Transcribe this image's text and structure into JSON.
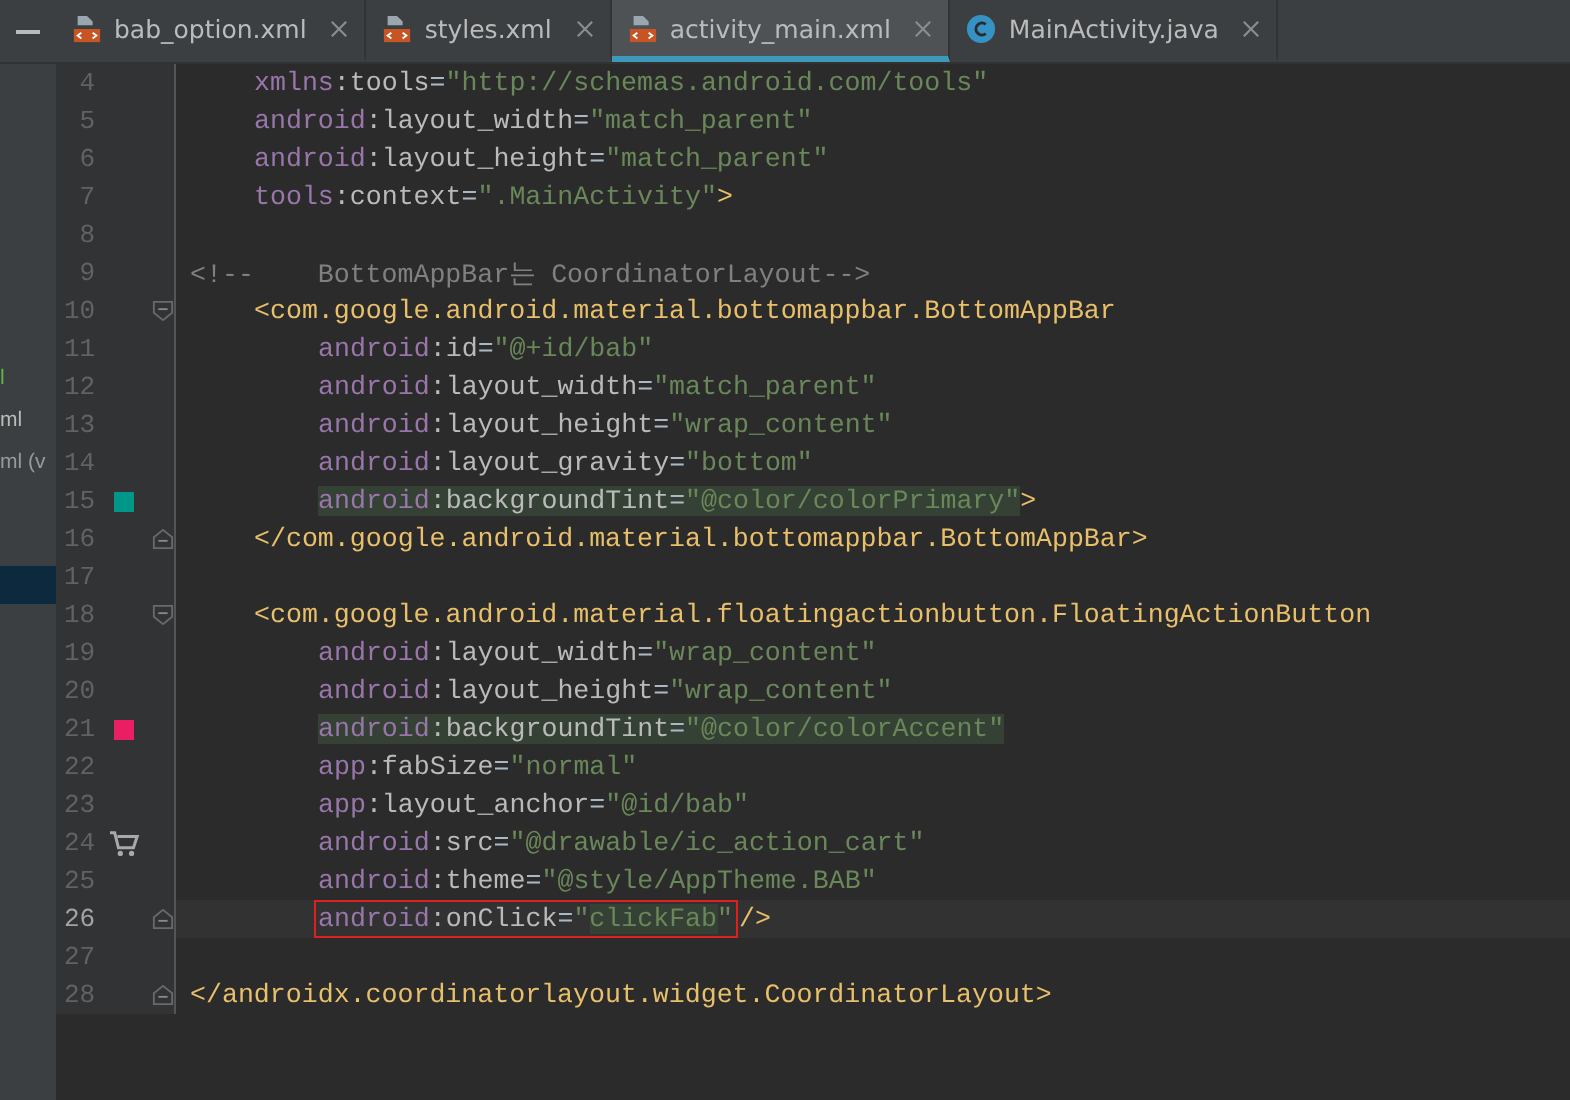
{
  "tabs": [
    {
      "label": "bab_option.xml",
      "kind": "xml",
      "selected": false
    },
    {
      "label": "styles.xml",
      "kind": "xml",
      "selected": false
    },
    {
      "label": "activity_main.xml",
      "kind": "xml",
      "selected": true
    },
    {
      "label": "MainActivity.java",
      "kind": "class",
      "selected": false
    }
  ],
  "sidebar": {
    "items": [
      {
        "text": "l",
        "color": "#62b543",
        "selected": false
      },
      {
        "text": "ml",
        "color": "#bbbbbb",
        "selected": false
      },
      {
        "text": "ml (v",
        "color": "#999999",
        "selected": false
      },
      {
        "selected": true
      }
    ]
  },
  "editor": {
    "lines": [
      {
        "number": "4",
        "kind": "attr",
        "segments": [
          {
            "kind": "text",
            "tokens": [
              {
                "t": "xmlns",
                "kind": "ns"
              },
              {
                "t": ":tools",
                "kind": "attr"
              },
              {
                "t": "=",
                "kind": "punct"
              },
              {
                "t": "\"http://schemas.android.com/tools\"",
                "kind": "value"
              }
            ]
          }
        ]
      },
      {
        "number": "5",
        "kind": "attr",
        "segments": [
          {
            "kind": "text",
            "tokens": [
              {
                "t": "android",
                "kind": "ns"
              },
              {
                "t": ":layout_width",
                "kind": "attr"
              },
              {
                "t": "=",
                "kind": "punct"
              },
              {
                "t": "\"match_parent\"",
                "kind": "value"
              }
            ]
          }
        ]
      },
      {
        "number": "6",
        "kind": "attr",
        "segments": [
          {
            "kind": "text",
            "tokens": [
              {
                "t": "android",
                "kind": "ns"
              },
              {
                "t": ":layout_height",
                "kind": "attr"
              },
              {
                "t": "=",
                "kind": "punct"
              },
              {
                "t": "\"match_parent\"",
                "kind": "value"
              }
            ]
          }
        ]
      },
      {
        "number": "7",
        "kind": "attr",
        "segments": [
          {
            "kind": "text",
            "tokens": [
              {
                "t": "tools",
                "kind": "ns"
              },
              {
                "t": ":context",
                "kind": "attr"
              },
              {
                "t": "=",
                "kind": "punct"
              },
              {
                "t": "\".MainActivity\"",
                "kind": "value"
              },
              {
                "t": ">",
                "kind": "tag"
              }
            ]
          }
        ]
      },
      {
        "number": "8",
        "kind": "blank"
      },
      {
        "number": "9",
        "kind": "flush",
        "segments": [
          {
            "kind": "text",
            "tokens": [
              {
                "t": "<!--    BottomAppBar는 CoordinatorLayout-->",
                "kind": "comment"
              }
            ]
          }
        ]
      },
      {
        "number": "10",
        "kind": "attr",
        "fold_start": true,
        "segments": [
          {
            "kind": "text",
            "tokens": [
              {
                "t": "<com.google.android.material.bottomappbar.BottomAppBar",
                "kind": "tag"
              }
            ]
          }
        ]
      },
      {
        "number": "11",
        "kind": "nested",
        "segments": [
          {
            "kind": "text",
            "tokens": [
              {
                "t": "android",
                "kind": "ns"
              },
              {
                "t": ":id",
                "kind": "attr"
              },
              {
                "t": "=",
                "kind": "punct"
              },
              {
                "t": "\"@+id/bab\"",
                "kind": "value"
              }
            ]
          }
        ]
      },
      {
        "number": "12",
        "kind": "nested",
        "segments": [
          {
            "kind": "text",
            "tokens": [
              {
                "t": "android",
                "kind": "ns"
              },
              {
                "t": ":layout_width",
                "kind": "attr"
              },
              {
                "t": "=",
                "kind": "punct"
              },
              {
                "t": "\"match_parent\"",
                "kind": "value"
              }
            ]
          }
        ]
      },
      {
        "number": "13",
        "kind": "nested",
        "segments": [
          {
            "kind": "text",
            "tokens": [
              {
                "t": "android",
                "kind": "ns"
              },
              {
                "t": ":layout_height",
                "kind": "attr"
              },
              {
                "t": "=",
                "kind": "punct"
              },
              {
                "t": "\"wrap_content\"",
                "kind": "value"
              }
            ]
          }
        ]
      },
      {
        "number": "14",
        "kind": "nested",
        "segments": [
          {
            "kind": "text",
            "tokens": [
              {
                "t": "android",
                "kind": "ns"
              },
              {
                "t": ":layout_gravity",
                "kind": "attr"
              },
              {
                "t": "=",
                "kind": "punct"
              },
              {
                "t": "\"bottom\"",
                "kind": "value"
              }
            ]
          }
        ]
      },
      {
        "number": "15",
        "kind": "nested",
        "gutter": {
          "kind": "color",
          "color": "#009688"
        },
        "segments": [
          {
            "kind": "highlight",
            "tokens": [
              {
                "t": "android",
                "kind": "ns"
              },
              {
                "t": ":backgroundTint",
                "kind": "attr"
              },
              {
                "t": "=",
                "kind": "punct"
              },
              {
                "t": "\"@color/colorPrimary\"",
                "kind": "value"
              }
            ]
          },
          {
            "kind": "text",
            "tokens": [
              {
                "t": ">",
                "kind": "tag"
              }
            ]
          }
        ]
      },
      {
        "number": "16",
        "kind": "attr",
        "fold_end": true,
        "segments": [
          {
            "kind": "text",
            "tokens": [
              {
                "t": "</com.google.android.material.bottomappbar.BottomAppBar>",
                "kind": "tag"
              }
            ]
          }
        ]
      },
      {
        "number": "17",
        "kind": "blank"
      },
      {
        "number": "18",
        "kind": "attr",
        "fold_start": true,
        "segments": [
          {
            "kind": "text",
            "tokens": [
              {
                "t": "<com.google.android.material.floatingactionbutton.FloatingActionButton",
                "kind": "tag"
              }
            ]
          }
        ]
      },
      {
        "number": "19",
        "kind": "nested",
        "segments": [
          {
            "kind": "text",
            "tokens": [
              {
                "t": "android",
                "kind": "ns"
              },
              {
                "t": ":layout_width",
                "kind": "attr"
              },
              {
                "t": "=",
                "kind": "punct"
              },
              {
                "t": "\"wrap_content\"",
                "kind": "value"
              }
            ]
          }
        ]
      },
      {
        "number": "20",
        "kind": "nested",
        "segments": [
          {
            "kind": "text",
            "tokens": [
              {
                "t": "android",
                "kind": "ns"
              },
              {
                "t": ":layout_height",
                "kind": "attr"
              },
              {
                "t": "=",
                "kind": "punct"
              },
              {
                "t": "\"wrap_content\"",
                "kind": "value"
              }
            ]
          }
        ]
      },
      {
        "number": "21",
        "kind": "nested",
        "gutter": {
          "kind": "color",
          "color": "#e91e63"
        },
        "segments": [
          {
            "kind": "highlight",
            "tokens": [
              {
                "t": "android",
                "kind": "ns"
              },
              {
                "t": ":backgroundTint",
                "kind": "attr"
              },
              {
                "t": "=",
                "kind": "punct"
              },
              {
                "t": "\"@color/colorAccent\"",
                "kind": "value"
              }
            ]
          }
        ]
      },
      {
        "number": "22",
        "kind": "nested",
        "segments": [
          {
            "kind": "text",
            "tokens": [
              {
                "t": "app",
                "kind": "ns"
              },
              {
                "t": ":fabSize",
                "kind": "attr"
              },
              {
                "t": "=",
                "kind": "punct"
              },
              {
                "t": "\"normal\"",
                "kind": "value"
              }
            ]
          }
        ]
      },
      {
        "number": "23",
        "kind": "nested",
        "segments": [
          {
            "kind": "text",
            "tokens": [
              {
                "t": "app",
                "kind": "ns"
              },
              {
                "t": ":layout_anchor",
                "kind": "attr"
              },
              {
                "t": "=",
                "kind": "punct"
              },
              {
                "t": "\"@id/bab\"",
                "kind": "value"
              }
            ]
          }
        ]
      },
      {
        "number": "24",
        "kind": "nested",
        "gutter": {
          "kind": "cart"
        },
        "segments": [
          {
            "kind": "text",
            "tokens": [
              {
                "t": "android",
                "kind": "ns"
              },
              {
                "t": ":src",
                "kind": "attr"
              },
              {
                "t": "=",
                "kind": "punct"
              },
              {
                "t": "\"@drawable/ic_action_cart\"",
                "kind": "value"
              }
            ]
          }
        ]
      },
      {
        "number": "25",
        "kind": "nested",
        "segments": [
          {
            "kind": "text",
            "tokens": [
              {
                "t": "android",
                "kind": "ns"
              },
              {
                "t": ":theme",
                "kind": "attr"
              },
              {
                "t": "=",
                "kind": "punct"
              },
              {
                "t": "\"@style/AppTheme.BAB\"",
                "kind": "value"
              }
            ]
          }
        ]
      },
      {
        "number": "26",
        "kind": "nested",
        "current": true,
        "fold_end": true,
        "segments": [
          {
            "kind": "box",
            "tokens": [
              {
                "t": "android",
                "kind": "ns"
              },
              {
                "t": ":onClick",
                "kind": "attr"
              },
              {
                "t": "=",
                "kind": "punct"
              },
              {
                "t": "\"",
                "kind": "value"
              },
              {
                "t": "clickFab",
                "kind": "usage"
              },
              {
                "t": "\"",
                "kind": "value"
              }
            ]
          },
          {
            "kind": "text",
            "tokens": [
              {
                "t": "/>",
                "kind": "tag"
              }
            ]
          }
        ]
      },
      {
        "number": "27",
        "kind": "blank"
      },
      {
        "number": "28",
        "kind": "flush",
        "fold_end": true,
        "segments": [
          {
            "kind": "text",
            "tokens": [
              {
                "t": "</androidx.coordinatorlayout.widget.CoordinatorLayout>",
                "kind": "tag"
              }
            ]
          }
        ]
      }
    ]
  }
}
